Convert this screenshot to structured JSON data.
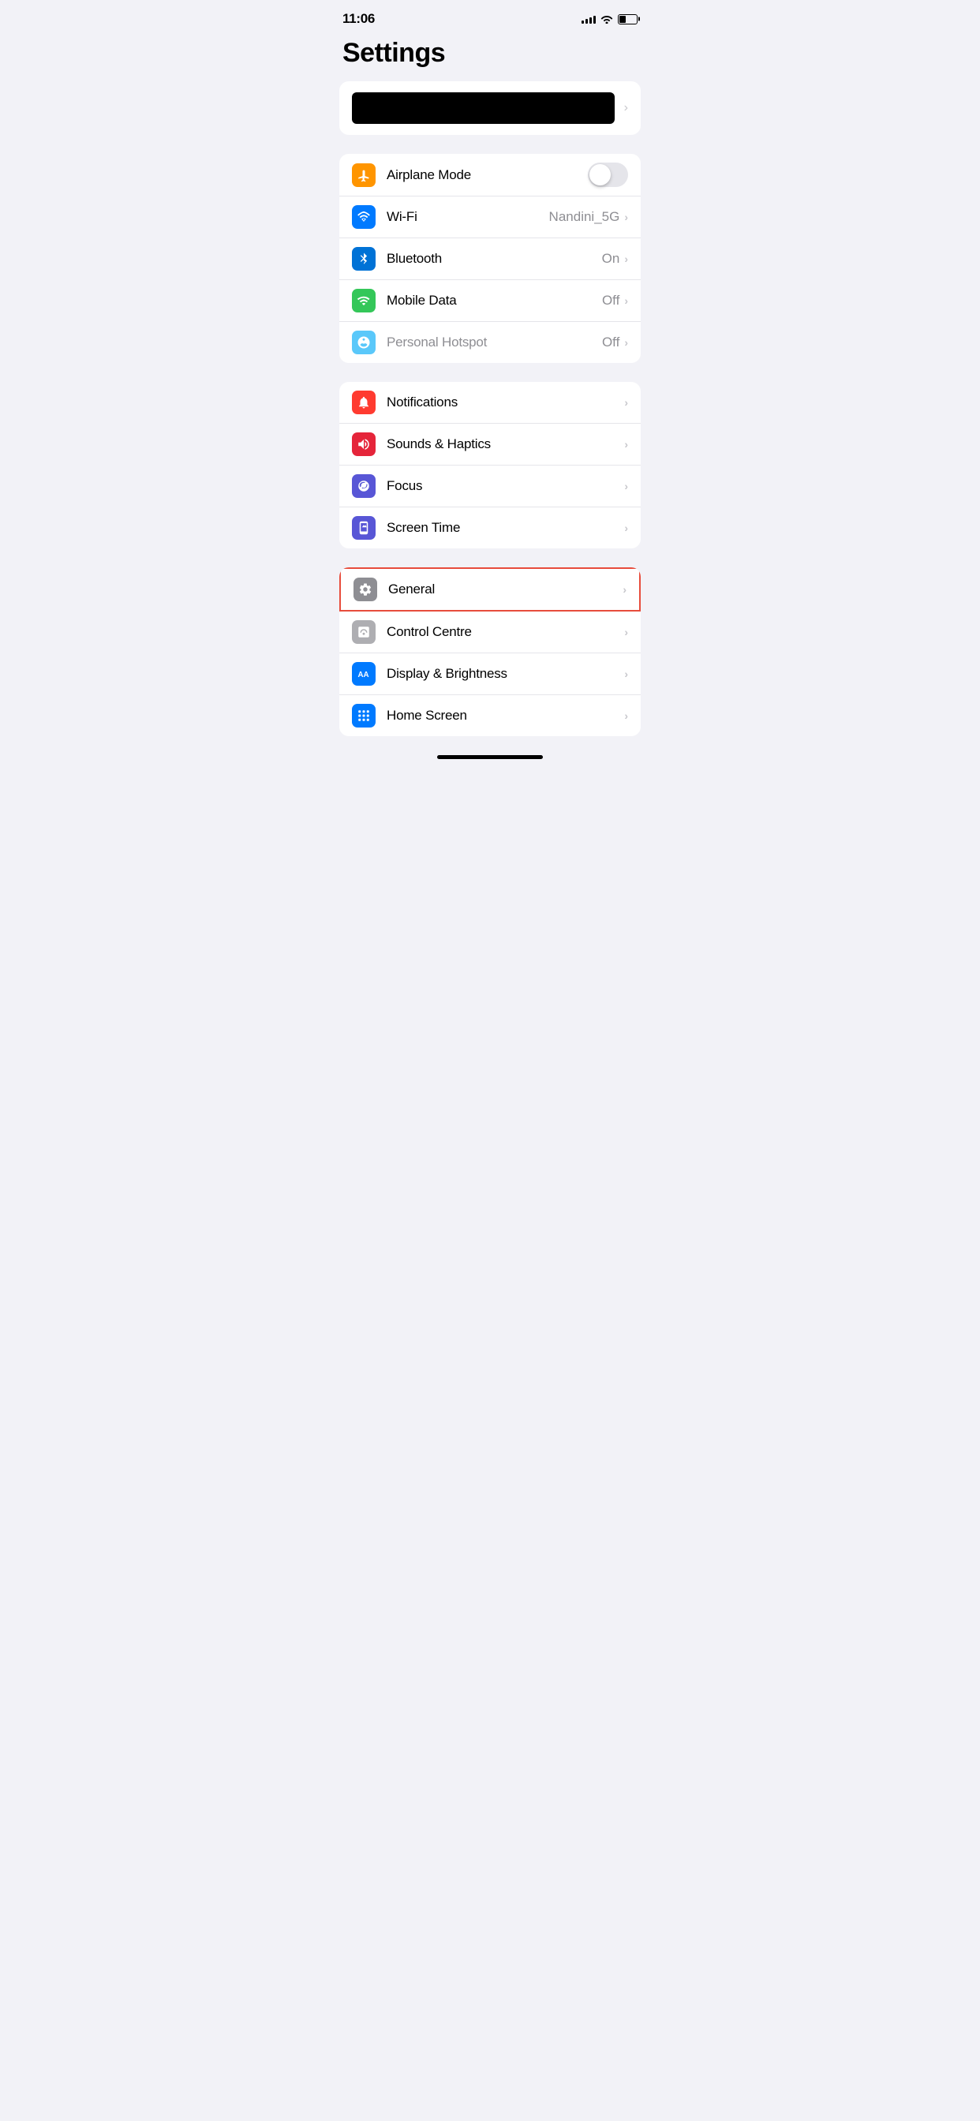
{
  "statusBar": {
    "time": "11:06",
    "signal": [
      3,
      5,
      7,
      9,
      11
    ],
    "battery_percent": 40
  },
  "pageTitle": "Settings",
  "profileCard": {
    "chevron": "›"
  },
  "groups": [
    {
      "id": "connectivity",
      "rows": [
        {
          "id": "airplane-mode",
          "label": "Airplane Mode",
          "iconColor": "icon-orange",
          "iconType": "airplane",
          "type": "toggle",
          "toggleState": "off",
          "value": "",
          "chevron": false
        },
        {
          "id": "wifi",
          "label": "Wi-Fi",
          "iconColor": "icon-blue",
          "iconType": "wifi",
          "type": "value-chevron",
          "value": "Nandini_5G",
          "chevron": true
        },
        {
          "id": "bluetooth",
          "label": "Bluetooth",
          "iconColor": "icon-blue-dark",
          "iconType": "bluetooth",
          "type": "value-chevron",
          "value": "On",
          "chevron": true
        },
        {
          "id": "mobile-data",
          "label": "Mobile Data",
          "iconColor": "icon-green",
          "iconType": "cellular",
          "type": "value-chevron",
          "value": "Off",
          "chevron": true
        },
        {
          "id": "personal-hotspot",
          "label": "Personal Hotspot",
          "iconColor": "icon-green-light",
          "iconType": "hotspot",
          "type": "value-chevron",
          "value": "Off",
          "chevron": true,
          "labelColor": "#8e8e93"
        }
      ]
    },
    {
      "id": "notifications",
      "rows": [
        {
          "id": "notifications",
          "label": "Notifications",
          "iconColor": "icon-red",
          "iconType": "bell",
          "type": "chevron",
          "value": "",
          "chevron": true
        },
        {
          "id": "sounds-haptics",
          "label": "Sounds & Haptics",
          "iconColor": "icon-red-dark",
          "iconType": "speaker",
          "type": "chevron",
          "value": "",
          "chevron": true
        },
        {
          "id": "focus",
          "label": "Focus",
          "iconColor": "icon-purple",
          "iconType": "moon",
          "type": "chevron",
          "value": "",
          "chevron": true
        },
        {
          "id": "screen-time",
          "label": "Screen Time",
          "iconColor": "icon-purple-dark",
          "iconType": "hourglass",
          "type": "chevron",
          "value": "",
          "chevron": true
        }
      ]
    },
    {
      "id": "general-group",
      "rows": [
        {
          "id": "general",
          "label": "General",
          "iconColor": "icon-gray",
          "iconType": "gear",
          "type": "chevron",
          "value": "",
          "chevron": true,
          "highlighted": true
        },
        {
          "id": "control-centre",
          "label": "Control Centre",
          "iconColor": "icon-gray-med",
          "iconType": "sliders",
          "type": "chevron",
          "value": "",
          "chevron": true
        },
        {
          "id": "display-brightness",
          "label": "Display & Brightness",
          "iconColor": "icon-blue",
          "iconType": "aa",
          "type": "chevron",
          "value": "",
          "chevron": true
        },
        {
          "id": "home-screen",
          "label": "Home Screen",
          "iconColor": "icon-blue",
          "iconType": "homescreen",
          "type": "chevron",
          "value": "",
          "chevron": true
        }
      ]
    }
  ],
  "chevronChar": "›",
  "homeIndicator": ""
}
